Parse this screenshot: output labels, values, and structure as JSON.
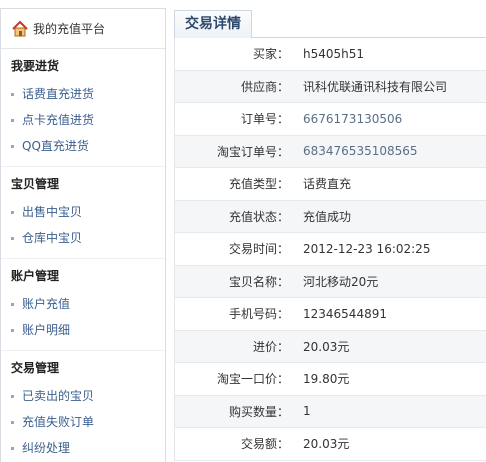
{
  "sidebar": {
    "header": "我的充值平台",
    "sections": [
      {
        "title": "我要进货",
        "items": [
          "话费直充进货",
          "点卡充值进货",
          "QQ直充进货"
        ]
      },
      {
        "title": "宝贝管理",
        "items": [
          "出售中宝贝",
          "仓库中宝贝"
        ]
      },
      {
        "title": "账户管理",
        "items": [
          "账户充值",
          "账户明细"
        ]
      },
      {
        "title": "交易管理",
        "items": [
          "已卖出的宝贝",
          "充值失败订单",
          "纠纷处理"
        ]
      }
    ]
  },
  "main": {
    "tab": "交易详情",
    "rows": [
      {
        "label": "买家：",
        "value": "h5405h51"
      },
      {
        "label": "供应商：",
        "value": "讯科优联通讯科技有限公司"
      },
      {
        "label": "订单号：",
        "value": "6676173130506"
      },
      {
        "label": "淘宝订单号：",
        "value": "683476535108565"
      },
      {
        "label": "充值类型：",
        "value": "话费直充"
      },
      {
        "label": "充值状态：",
        "value": "充值成功"
      },
      {
        "label": "交易时间：",
        "value": "2012-12-23 16:02:25"
      },
      {
        "label": "宝贝名称：",
        "value": "河北移动20元"
      },
      {
        "label": "手机号码：",
        "value": "12346544891"
      },
      {
        "label": "进价：",
        "value": "20.03元"
      },
      {
        "label": "淘宝一口价：",
        "value": "19.80元"
      },
      {
        "label": "购买数量：",
        "value": "1"
      },
      {
        "label": "交易额：",
        "value": "20.03元"
      }
    ]
  },
  "icons": {
    "home": "home-icon"
  },
  "colors": {
    "link": "#3a5f8f",
    "tab_text": "#2d4a6e",
    "alt_row": "#f4f6f8"
  }
}
